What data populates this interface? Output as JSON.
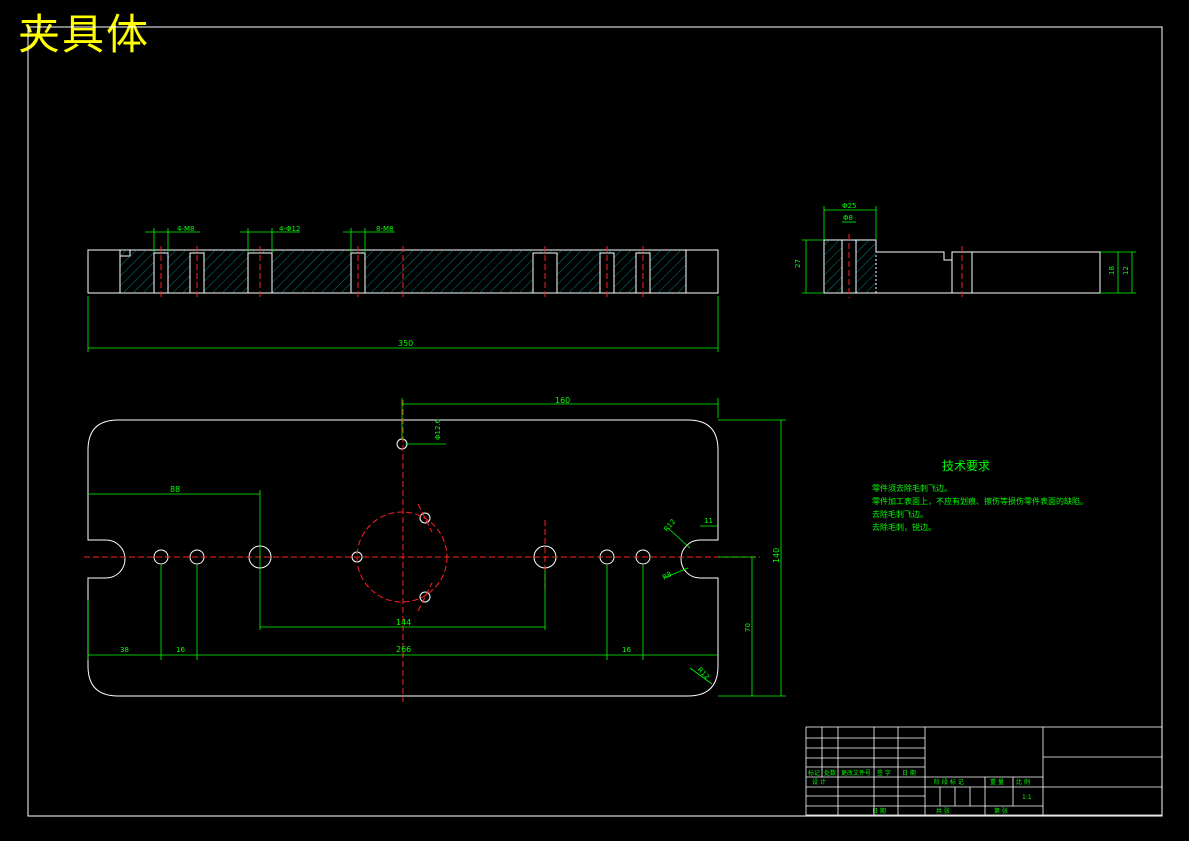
{
  "title": "夹具体",
  "technical_requirements": {
    "heading": "技术要求",
    "lines": [
      "零件须去除毛刺飞边。",
      "零件加工表面上，不应有划痕、擦伤等损伤零件表面的缺陷。",
      "去除毛刺飞边。",
      "去除毛刺，锐边。"
    ]
  },
  "dimensions": {
    "front_holes_left": "4-M8",
    "front_holes_mid": "4-Φ12",
    "front_holes_right": "8-M8",
    "front_overall": "350",
    "side_top_outer": "Φ25",
    "side_top_inner": "Φ8",
    "side_left_height": "27",
    "side_right_h1": "18",
    "side_right_h2": "12",
    "plan_top_span": "160",
    "plan_small_hole": "Φ12.6",
    "plan_left_offset": "88",
    "plan_bore_span": "144",
    "plan_bottom_left": "38",
    "plan_bottom_16a": "16",
    "plan_bottom_mid": "266",
    "plan_bottom_16b": "16",
    "plan_right_offset": "11",
    "plan_slot_r": "R12",
    "plan_slot_r2": "R8",
    "plan_height_half": "70",
    "plan_height_full": "140",
    "plan_corner_r": "R12"
  },
  "title_block": {
    "row_labels": [
      "标记",
      "处数",
      "更改文件号",
      "签 字",
      "日 期"
    ],
    "design": "设 计",
    "approve": "日 期",
    "stage_labels": [
      "阶 段 标 记",
      "重 量",
      "比 例"
    ],
    "scale": "1:1",
    "sheet_labels": [
      "共 张",
      "第 张"
    ]
  }
}
